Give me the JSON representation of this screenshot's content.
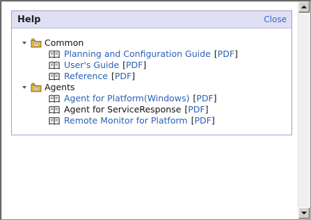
{
  "panel": {
    "title": "Help",
    "close_label": "Close"
  },
  "tree": [
    {
      "label": "Common",
      "items": [
        {
          "label": "Planning and Configuration Guide",
          "link": true,
          "pdf": "PDF"
        },
        {
          "label": "User's Guide",
          "link": true,
          "pdf": "PDF"
        },
        {
          "label": "Reference",
          "link": true,
          "pdf": "PDF"
        }
      ]
    },
    {
      "label": "Agents",
      "items": [
        {
          "label": "Agent for Platform(Windows)",
          "link": true,
          "pdf": "PDF"
        },
        {
          "label": "Agent for ServiceResponse",
          "link": false,
          "pdf": "PDF"
        },
        {
          "label": "Remote Monitor for Platform",
          "link": true,
          "pdf": "PDF"
        }
      ]
    }
  ],
  "colors": {
    "header_bg": "#dfe0f4",
    "link": "#2a5fb5",
    "close": "#3366cc"
  },
  "icons": {
    "folder": "folder-icon",
    "book": "book-icon",
    "expand": "expand-triangle-icon"
  }
}
